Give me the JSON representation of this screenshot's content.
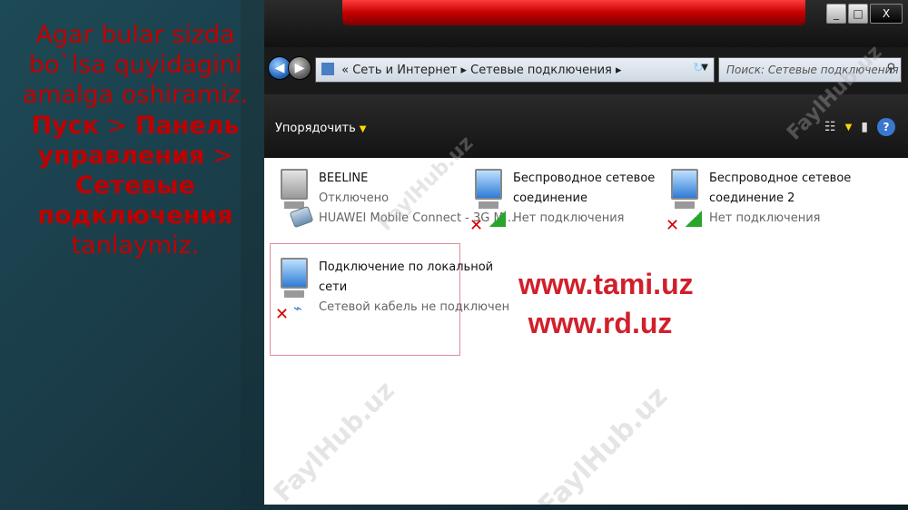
{
  "slide": {
    "line1": "Agar bular sizda bo`lsa quyidagini amalga oshiramiz.",
    "path_start": "Пуск",
    "separator": ">",
    "path_mid": "Панель управления",
    "path_end": "Сетевые подключения",
    "line_end": "tanlaymiz."
  },
  "window": {
    "buttons": {
      "minimize": "_",
      "restore": "□",
      "close": "X"
    }
  },
  "address": {
    "back": "◀",
    "forward": "▶",
    "breadcrumb": "« Сеть и Интернет ▸ Сетевые подключения ▸",
    "search_placeholder": "Поиск: Сетевые подключения"
  },
  "toolbar": {
    "organize_label": "Упорядочить"
  },
  "connections": [
    {
      "name": "BEELINE",
      "status": "Отключено",
      "device": "HUAWEI Mobile Connect - 3G M..."
    },
    {
      "name": "Беспроводное сетевое",
      "name2": "соединение",
      "status": "Нет подключения"
    },
    {
      "name": "Беспроводное сетевое",
      "name2": "соединение 2",
      "status": "Нет подключения"
    },
    {
      "name": "Подключение по локальной",
      "name2": "сети",
      "status": "Сетевой кабель не подключен"
    }
  ],
  "promo": {
    "line1": "www.tami.uz",
    "line2": "www.rd.uz"
  },
  "watermark": "FaylHub.uz"
}
